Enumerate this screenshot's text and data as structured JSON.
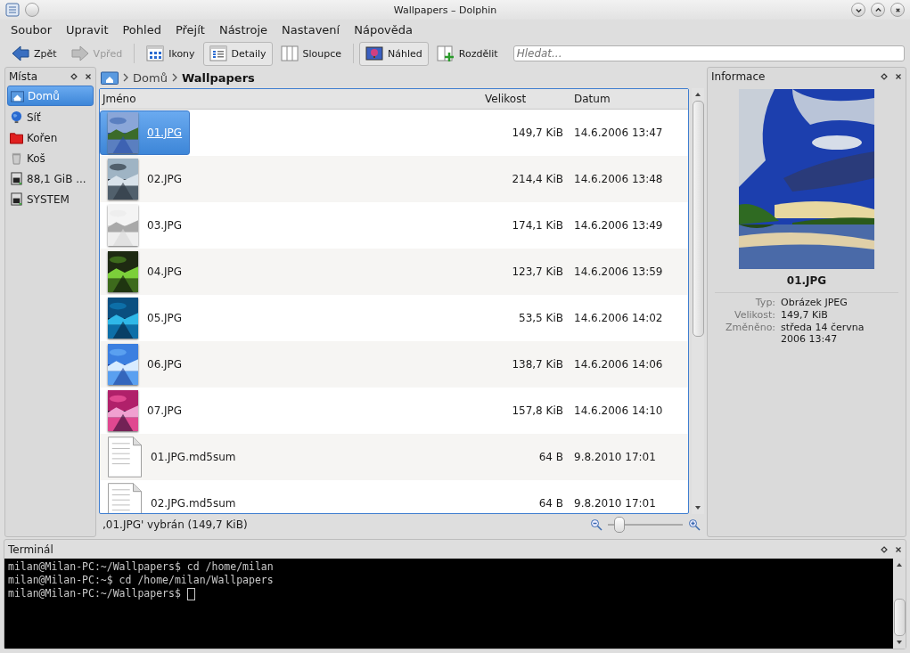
{
  "window": {
    "title": "Wallpapers – Dolphin"
  },
  "menu": [
    "Soubor",
    "Upravit",
    "Pohled",
    "Přejít",
    "Nástroje",
    "Nastavení",
    "Nápověda"
  ],
  "toolbar": {
    "groups": [
      [
        {
          "label": "Zpět",
          "kind": "back",
          "disabled": false,
          "pressed": false
        },
        {
          "label": "Vpřed",
          "kind": "forward",
          "disabled": true,
          "pressed": false
        }
      ],
      [
        {
          "label": "Ikony",
          "kind": "icons",
          "disabled": false,
          "pressed": false
        },
        {
          "label": "Detaily",
          "kind": "details",
          "disabled": false,
          "pressed": true
        },
        {
          "label": "Sloupce",
          "kind": "columns",
          "disabled": false,
          "pressed": false
        }
      ],
      [
        {
          "label": "Náhled",
          "kind": "preview",
          "disabled": false,
          "pressed": true
        },
        {
          "label": "Rozdělit",
          "kind": "split",
          "disabled": false,
          "pressed": false
        }
      ]
    ],
    "search": {
      "placeholder": "Hledat..."
    }
  },
  "places": {
    "title": "Místa",
    "items": [
      {
        "label": "Domů",
        "kind": "home",
        "selected": true
      },
      {
        "label": "Síť",
        "kind": "network",
        "selected": false
      },
      {
        "label": "Kořen",
        "kind": "root",
        "selected": false
      },
      {
        "label": "Koš",
        "kind": "trash",
        "selected": false
      },
      {
        "label": "88,1 GiB ...",
        "kind": "drive",
        "selected": false
      },
      {
        "label": "SYSTEM",
        "kind": "drive",
        "selected": false
      }
    ]
  },
  "breadcrumb": [
    "Domů",
    "Wallpapers"
  ],
  "table": {
    "columns": [
      "Jméno",
      "Velikost",
      "Datum"
    ],
    "rows": [
      {
        "name": "01.JPG",
        "size": "149,7 KiB",
        "date": "14.6.2006 13:47",
        "selected": true
      },
      {
        "name": "02.JPG",
        "size": "214,4 KiB",
        "date": "14.6.2006 13:48",
        "selected": false
      },
      {
        "name": "03.JPG",
        "size": "174,1 KiB",
        "date": "14.6.2006 13:49",
        "selected": false
      },
      {
        "name": "04.JPG",
        "size": "123,7 KiB",
        "date": "14.6.2006 13:59",
        "selected": false
      },
      {
        "name": "05.JPG",
        "size": "53,5 KiB",
        "date": "14.6.2006 14:02",
        "selected": false
      },
      {
        "name": "06.JPG",
        "size": "138,7 KiB",
        "date": "14.6.2006 14:06",
        "selected": false
      },
      {
        "name": "07.JPG",
        "size": "157,8 KiB",
        "date": "14.6.2006 14:10",
        "selected": false
      },
      {
        "name": "01.JPG.md5sum",
        "size": "64 B",
        "date": "9.8.2010 17:01",
        "kind": "text",
        "selected": false
      },
      {
        "name": "02.JPG.md5sum",
        "size": "64 B",
        "date": "9.8.2010 17:01",
        "kind": "text",
        "selected": false
      }
    ]
  },
  "status_bar": {
    "text": "‚01.JPG' vybrán (149,7 KiB)",
    "zoom": {
      "level": 0.12
    }
  },
  "info": {
    "title": "Informace",
    "name": "01.JPG",
    "properties": [
      {
        "label": "Typ:",
        "value": "Obrázek JPEG"
      },
      {
        "label": "Velikost:",
        "value": "149,7 KiB"
      },
      {
        "label": "Změněno:",
        "value": "středa 14 června 2006 13:47"
      }
    ]
  },
  "terminal": {
    "title": "Terminál",
    "lines": [
      "milan@Milan-PC:~/Wallpapers$ cd /home/milan",
      "milan@Milan-PC:~$ cd /home/milan/Wallpapers",
      "milan@Milan-PC:~/Wallpapers$ "
    ]
  }
}
